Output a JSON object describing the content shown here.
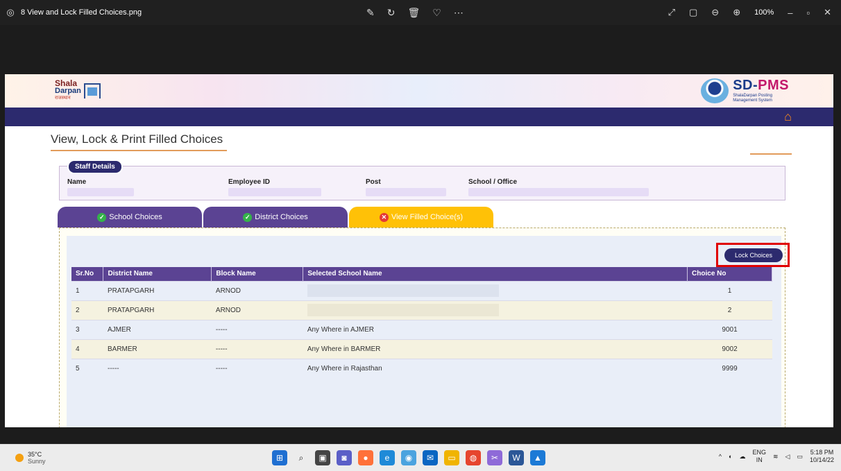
{
  "window": {
    "filename": "8 View and Lock Filled Choices.png",
    "zoom": "100%"
  },
  "site": {
    "logo_left_line1": "Shala",
    "logo_left_line2": "Darpan",
    "logo_left_line3": "राजस्थान",
    "logo_right_title_a": "SD-",
    "logo_right_title_b": "PMS",
    "logo_right_sub1": "ShalaDarpan Posting",
    "logo_right_sub2": "Management System"
  },
  "page": {
    "title": "View, Lock & Print Filled Choices"
  },
  "staff": {
    "pill": "Staff Details",
    "labels": {
      "name": "Name",
      "employee_id": "Employee ID",
      "post": "Post",
      "school": "School / Office"
    }
  },
  "tabs": [
    {
      "label": "School Choices",
      "status": "done"
    },
    {
      "label": "District Choices",
      "status": "done"
    },
    {
      "label": "View Filled Choice(s)",
      "status": "active"
    }
  ],
  "actions": {
    "lock_label": "Lock Choices"
  },
  "table": {
    "headers": [
      "Sr.No",
      "District Name",
      "Block Name",
      "Selected School Name",
      "Choice No"
    ],
    "rows": [
      [
        "1",
        "PRATAPGARH",
        "ARNOD",
        "",
        "1"
      ],
      [
        "2",
        "PRATAPGARH",
        "ARNOD",
        "",
        "2"
      ],
      [
        "3",
        "AJMER",
        "-----",
        "Any Where in AJMER",
        "9001"
      ],
      [
        "4",
        "BARMER",
        "-----",
        "Any Where in BARMER",
        "9002"
      ],
      [
        "5",
        "-----",
        "-----",
        "Any Where in Rajasthan",
        "9999"
      ]
    ]
  },
  "taskbar": {
    "temp": "35°C",
    "weather": "Sunny",
    "lang_top": "ENG",
    "lang_bottom": "IN",
    "time": "5:18 PM",
    "date": "10/14/22"
  },
  "colors": {
    "navbar": "#2c2a6e",
    "tab_purple": "#5b4393",
    "tab_active": "#ffc107",
    "highlight_box": "#e00000"
  }
}
